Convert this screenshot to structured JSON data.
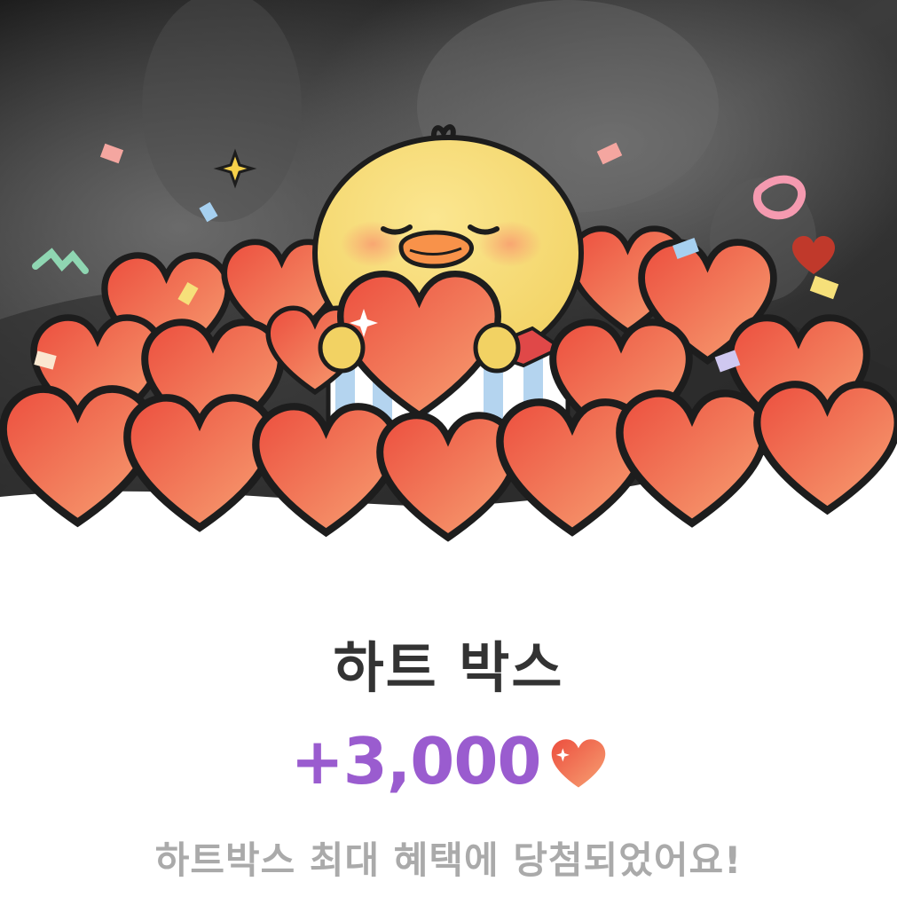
{
  "reward": {
    "title": "하트 박스",
    "amount": "+3,000",
    "message": "하트박스 최대 혜택에 당첨되었어요!"
  },
  "icons": {
    "amount_icon": "heart-icon",
    "mascot": "yellow-chick-mascot"
  },
  "colors": {
    "accent_purple": "#9a5ccf",
    "heart_red": "#ec4e3e",
    "heart_orange": "#f7a173",
    "title_text": "#333333",
    "message_text": "#aaaaaa",
    "background": "#ffffff"
  }
}
